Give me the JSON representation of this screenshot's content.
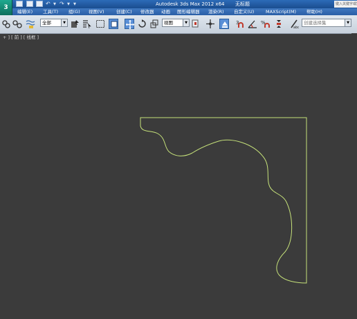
{
  "window": {
    "title": "Autodesk 3ds Max  2012 x64",
    "document": "无标题",
    "search_placeholder": "键入关键字或短语"
  },
  "app_logo": "3",
  "menu": [
    {
      "label": "编辑(E)"
    },
    {
      "label": "工具(T)"
    },
    {
      "label": "组(G)"
    },
    {
      "label": "视图(V)"
    },
    {
      "label": "创建(C)"
    },
    {
      "label": "修改器"
    },
    {
      "label": "动画"
    },
    {
      "label": "图形编辑器"
    },
    {
      "label": "渲染(R)"
    },
    {
      "label": "自定义(U)"
    },
    {
      "label": "MAXScript(M)"
    },
    {
      "label": "帮助(H)"
    }
  ],
  "toolbar": {
    "selection_filter": "全部",
    "reference_coord": "视图",
    "named_selection": "创建选择集"
  },
  "viewport": {
    "label": "+ ] [ 前 ] [ 线框 ]"
  },
  "colors": {
    "viewport_bg": "#3b3b3b",
    "spline": "#c6e27a",
    "titlebar": "#1a4d8f"
  }
}
